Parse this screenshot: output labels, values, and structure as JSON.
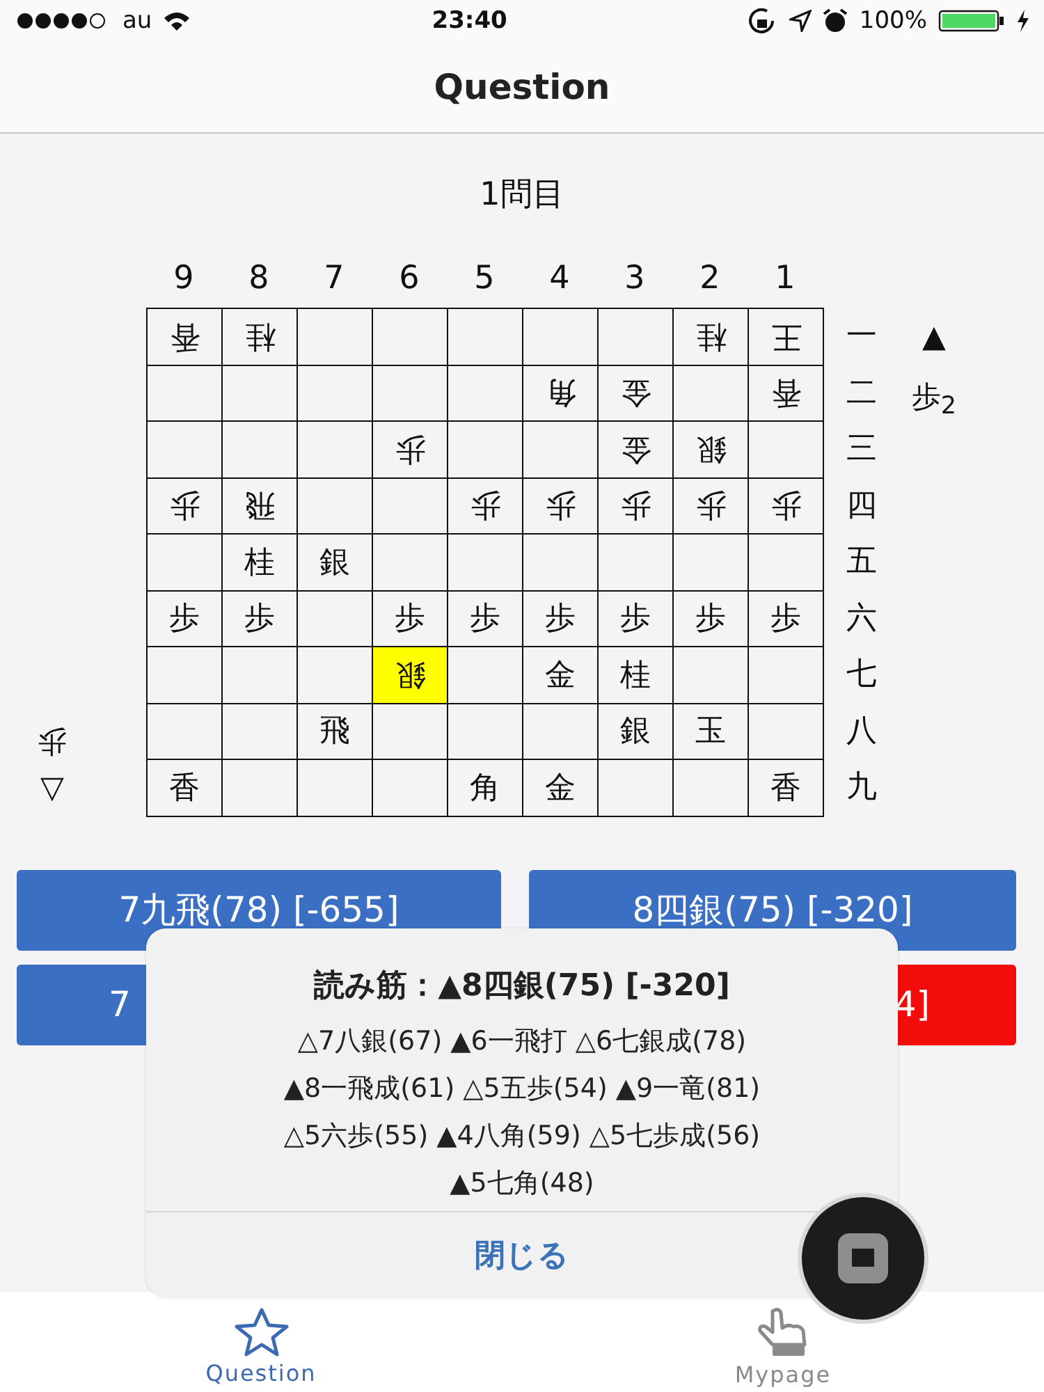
{
  "status_bar": {
    "carrier": "au",
    "time": "23:40",
    "battery": "100%"
  },
  "nav": {
    "title": "Question"
  },
  "problem_label": "1問目",
  "board": {
    "files": [
      "9",
      "8",
      "7",
      "6",
      "5",
      "4",
      "3",
      "2",
      "1"
    ],
    "ranks": [
      "一",
      "二",
      "三",
      "四",
      "五",
      "六",
      "七",
      "八",
      "九"
    ],
    "rows": [
      [
        {
          "kind": "piece",
          "piece": "香",
          "upside_down": true,
          "highlighted": false
        },
        {
          "kind": "piece",
          "piece": "桂",
          "upside_down": true,
          "highlighted": false
        },
        {
          "kind": "empty",
          "highlighted": false
        },
        {
          "kind": "empty",
          "highlighted": false
        },
        {
          "kind": "empty",
          "highlighted": false
        },
        {
          "kind": "empty",
          "highlighted": false
        },
        {
          "kind": "empty",
          "highlighted": false
        },
        {
          "kind": "piece",
          "piece": "桂",
          "upside_down": true,
          "highlighted": false
        },
        {
          "kind": "piece",
          "piece": "王",
          "upside_down": true,
          "highlighted": false
        }
      ],
      [
        {
          "kind": "empty",
          "highlighted": false
        },
        {
          "kind": "empty",
          "highlighted": false
        },
        {
          "kind": "empty",
          "highlighted": false
        },
        {
          "kind": "empty",
          "highlighted": false
        },
        {
          "kind": "empty",
          "highlighted": false
        },
        {
          "kind": "piece",
          "piece": "角",
          "upside_down": true,
          "highlighted": false
        },
        {
          "kind": "piece",
          "piece": "金",
          "upside_down": true,
          "highlighted": false
        },
        {
          "kind": "empty",
          "highlighted": false
        },
        {
          "kind": "piece",
          "piece": "香",
          "upside_down": true,
          "highlighted": false
        }
      ],
      [
        {
          "kind": "empty",
          "highlighted": false
        },
        {
          "kind": "empty",
          "highlighted": false
        },
        {
          "kind": "empty",
          "highlighted": false
        },
        {
          "kind": "piece",
          "piece": "歩",
          "upside_down": true,
          "highlighted": false
        },
        {
          "kind": "empty",
          "highlighted": false
        },
        {
          "kind": "empty",
          "highlighted": false
        },
        {
          "kind": "piece",
          "piece": "金",
          "upside_down": true,
          "highlighted": false
        },
        {
          "kind": "piece",
          "piece": "銀",
          "upside_down": true,
          "highlighted": false
        },
        {
          "kind": "empty",
          "highlighted": false
        }
      ],
      [
        {
          "kind": "piece",
          "piece": "歩",
          "upside_down": true,
          "highlighted": false
        },
        {
          "kind": "piece",
          "piece": "飛",
          "upside_down": true,
          "highlighted": false
        },
        {
          "kind": "empty",
          "highlighted": false
        },
        {
          "kind": "empty",
          "highlighted": false
        },
        {
          "kind": "piece",
          "piece": "歩",
          "upside_down": true,
          "highlighted": false
        },
        {
          "kind": "piece",
          "piece": "歩",
          "upside_down": true,
          "highlighted": false
        },
        {
          "kind": "piece",
          "piece": "歩",
          "upside_down": true,
          "highlighted": false
        },
        {
          "kind": "piece",
          "piece": "歩",
          "upside_down": true,
          "highlighted": false
        },
        {
          "kind": "piece",
          "piece": "歩",
          "upside_down": true,
          "highlighted": false
        }
      ],
      [
        {
          "kind": "empty",
          "highlighted": false
        },
        {
          "kind": "piece",
          "piece": "桂",
          "upside_down": false,
          "highlighted": false
        },
        {
          "kind": "piece",
          "piece": "銀",
          "upside_down": false,
          "highlighted": false
        },
        {
          "kind": "empty",
          "highlighted": false
        },
        {
          "kind": "empty",
          "highlighted": false
        },
        {
          "kind": "empty",
          "highlighted": false
        },
        {
          "kind": "empty",
          "highlighted": false
        },
        {
          "kind": "empty",
          "highlighted": false
        },
        {
          "kind": "empty",
          "highlighted": false
        }
      ],
      [
        {
          "kind": "piece",
          "piece": "歩",
          "upside_down": false,
          "highlighted": false
        },
        {
          "kind": "piece",
          "piece": "歩",
          "upside_down": false,
          "highlighted": false
        },
        {
          "kind": "empty",
          "highlighted": false
        },
        {
          "kind": "piece",
          "piece": "歩",
          "upside_down": false,
          "highlighted": false
        },
        {
          "kind": "piece",
          "piece": "歩",
          "upside_down": false,
          "highlighted": false
        },
        {
          "kind": "piece",
          "piece": "歩",
          "upside_down": false,
          "highlighted": false
        },
        {
          "kind": "piece",
          "piece": "歩",
          "upside_down": false,
          "highlighted": false
        },
        {
          "kind": "piece",
          "piece": "歩",
          "upside_down": false,
          "highlighted": false
        },
        {
          "kind": "piece",
          "piece": "歩",
          "upside_down": false,
          "highlighted": false
        }
      ],
      [
        {
          "kind": "empty",
          "highlighted": false
        },
        {
          "kind": "empty",
          "highlighted": false
        },
        {
          "kind": "empty",
          "highlighted": false
        },
        {
          "kind": "piece",
          "piece": "銀",
          "upside_down": true,
          "highlighted": true
        },
        {
          "kind": "empty",
          "highlighted": false
        },
        {
          "kind": "piece",
          "piece": "金",
          "upside_down": false,
          "highlighted": false
        },
        {
          "kind": "piece",
          "piece": "桂",
          "upside_down": false,
          "highlighted": false
        },
        {
          "kind": "empty",
          "highlighted": false
        },
        {
          "kind": "empty",
          "highlighted": false
        }
      ],
      [
        {
          "kind": "empty",
          "highlighted": false
        },
        {
          "kind": "empty",
          "highlighted": false
        },
        {
          "kind": "piece",
          "piece": "飛",
          "upside_down": false,
          "highlighted": false
        },
        {
          "kind": "empty",
          "highlighted": false
        },
        {
          "kind": "empty",
          "highlighted": false
        },
        {
          "kind": "empty",
          "highlighted": false
        },
        {
          "kind": "piece",
          "piece": "銀",
          "upside_down": false,
          "highlighted": false
        },
        {
          "kind": "piece",
          "piece": "玉",
          "upside_down": false,
          "highlighted": false
        },
        {
          "kind": "empty",
          "highlighted": false
        }
      ],
      [
        {
          "kind": "piece",
          "piece": "香",
          "upside_down": false,
          "highlighted": false
        },
        {
          "kind": "empty",
          "highlighted": false
        },
        {
          "kind": "empty",
          "highlighted": false
        },
        {
          "kind": "empty",
          "highlighted": false
        },
        {
          "kind": "piece",
          "piece": "角",
          "upside_down": false,
          "highlighted": false
        },
        {
          "kind": "piece",
          "piece": "金",
          "upside_down": false,
          "highlighted": false
        },
        {
          "kind": "empty",
          "highlighted": false
        },
        {
          "kind": "empty",
          "highlighted": false
        },
        {
          "kind": "piece",
          "piece": "香",
          "upside_down": false,
          "highlighted": false
        }
      ]
    ]
  },
  "sente_hand": {
    "mark": "▲",
    "pieces": [
      {
        "piece": "歩",
        "count": "2"
      }
    ]
  },
  "gote_hand": {
    "mark": "▽",
    "pieces": [
      {
        "piece": "歩"
      }
    ]
  },
  "answer_buttons": [
    {
      "label": "7九飛(78) [-655]",
      "color": "#3a6fc4"
    },
    {
      "label": "8四銀(75) [-320]",
      "color": "#3a6fc4"
    },
    {
      "label": "7",
      "color": "#3a6fc4"
    },
    {
      "label": "4]",
      "color": "#f20c0c"
    }
  ],
  "dialog": {
    "title": "読み筋：▲8四銀(75) [-320]",
    "lines": [
      "△7八銀(67) ▲6一飛打 △6七銀成(78)",
      "▲8一飛成(61) △5五歩(54) ▲9一竜(81)",
      "△5六歩(55) ▲4八角(59) △5七歩成(56)",
      "▲5七角(48)"
    ],
    "close": "閉じる"
  },
  "tab_bar": [
    {
      "label": "Question",
      "selected": true,
      "kind": "star"
    },
    {
      "label": "Mypage",
      "selected": false,
      "kind": "hand"
    }
  ]
}
